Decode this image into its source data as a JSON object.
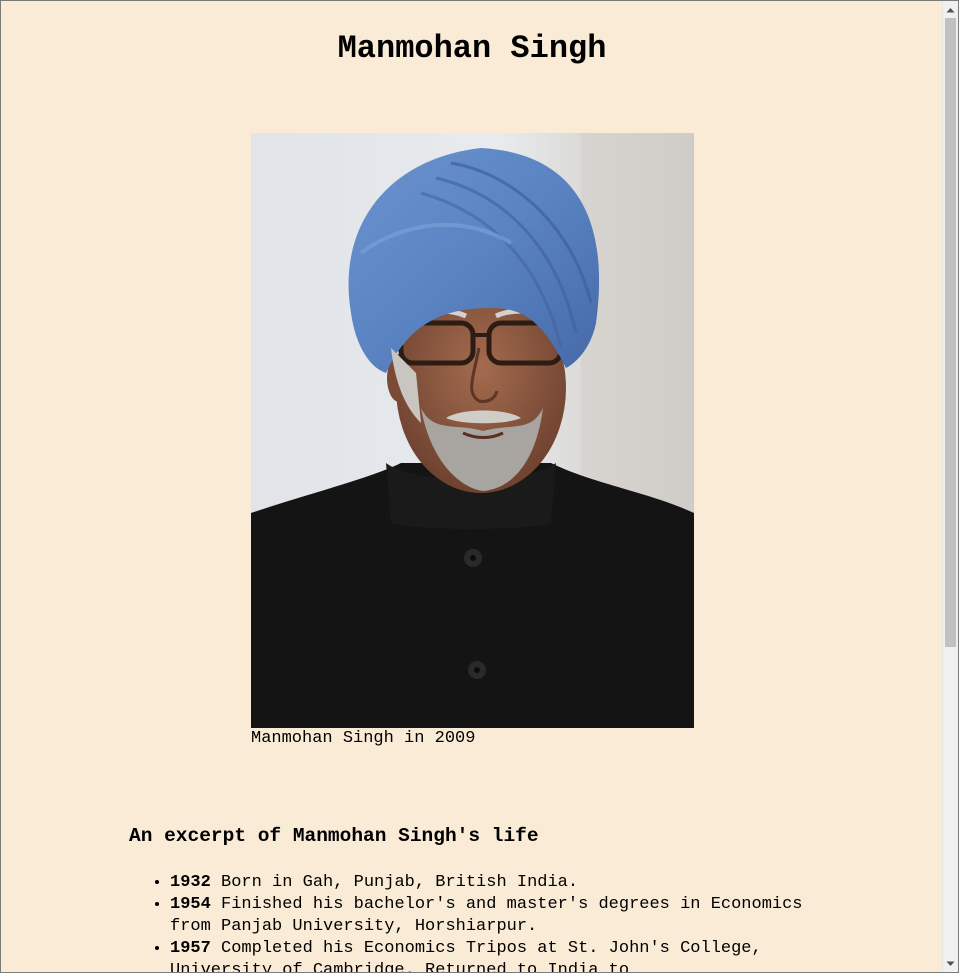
{
  "page": {
    "title": "Manmohan Singh",
    "background_color": "#faebd7"
  },
  "figure": {
    "image_alt": "Portrait photo of Manmohan Singh wearing a blue turban and glasses",
    "caption": "Manmohan Singh in 2009"
  },
  "excerpt": {
    "heading": "An excerpt of Manmohan Singh's life",
    "items": [
      {
        "year": "1932",
        "text": " Born in Gah, Punjab, British India."
      },
      {
        "year": "1954",
        "text": " Finished his bachelor's and master's degrees in Economics from Panjab University, Horshiarpur."
      },
      {
        "year": "1957",
        "text": " Completed his Economics Tripos at St. John's College, University of Cambridge. Returned to India to"
      }
    ]
  },
  "scrollbar": {
    "up_icon": "scroll-up-arrow-icon",
    "down_icon": "scroll-down-arrow-icon",
    "position_fraction": 0.0,
    "visible_fraction": 0.66
  }
}
